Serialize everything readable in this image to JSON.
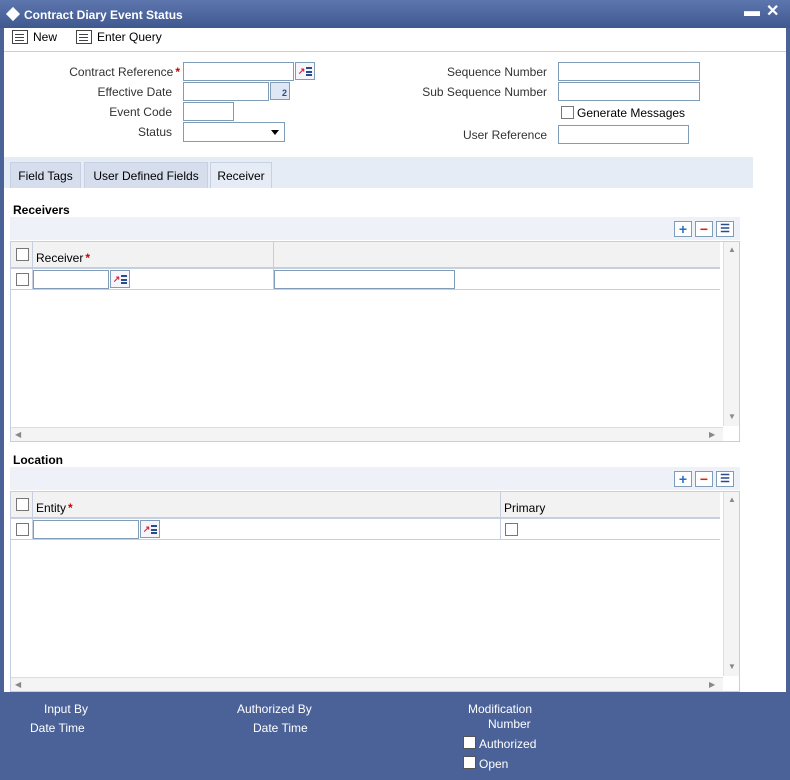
{
  "window": {
    "title": "Contract Diary Event Status",
    "minimize": "▬",
    "close": "✕"
  },
  "toolbar": {
    "new_label": "New",
    "enter_query_label": "Enter Query"
  },
  "form": {
    "contract_reference": {
      "label": "Contract Reference",
      "value": ""
    },
    "effective_date": {
      "label": "Effective Date",
      "value": "",
      "calendar_glyph": "2"
    },
    "event_code": {
      "label": "Event Code",
      "value": ""
    },
    "status": {
      "label": "Status",
      "value": ""
    },
    "sequence_number": {
      "label": "Sequence Number",
      "value": ""
    },
    "sub_sequence_number": {
      "label": "Sub Sequence Number",
      "value": ""
    },
    "generate_messages": {
      "label": "Generate Messages",
      "checked": false
    },
    "user_reference": {
      "label": "User Reference",
      "value": ""
    },
    "required_mark": "*"
  },
  "tabs": [
    {
      "label": "Field Tags"
    },
    {
      "label": "User Defined Fields"
    },
    {
      "label": "Receiver"
    }
  ],
  "receivers": {
    "title": "Receivers",
    "columns": [
      "Receiver",
      ""
    ],
    "rows": [
      {
        "receiver": "",
        "second": ""
      }
    ]
  },
  "location": {
    "title": "Location",
    "columns": [
      "Entity",
      "Primary"
    ],
    "rows": [
      {
        "entity": "",
        "primary": false
      }
    ]
  },
  "grid_buttons": {
    "add": "+",
    "delete": "−",
    "view": "☰"
  },
  "footer": {
    "input_by": "Input By",
    "date_time_1": "Date Time",
    "authorized_by": "Authorized By",
    "date_time_2": "Date Time",
    "modification": "Modification",
    "number": "Number",
    "authorized": "Authorized",
    "open": "Open"
  },
  "colors": {
    "titlebar": "#4a6298",
    "footer": "#4a6298",
    "required": "#cc0000"
  }
}
